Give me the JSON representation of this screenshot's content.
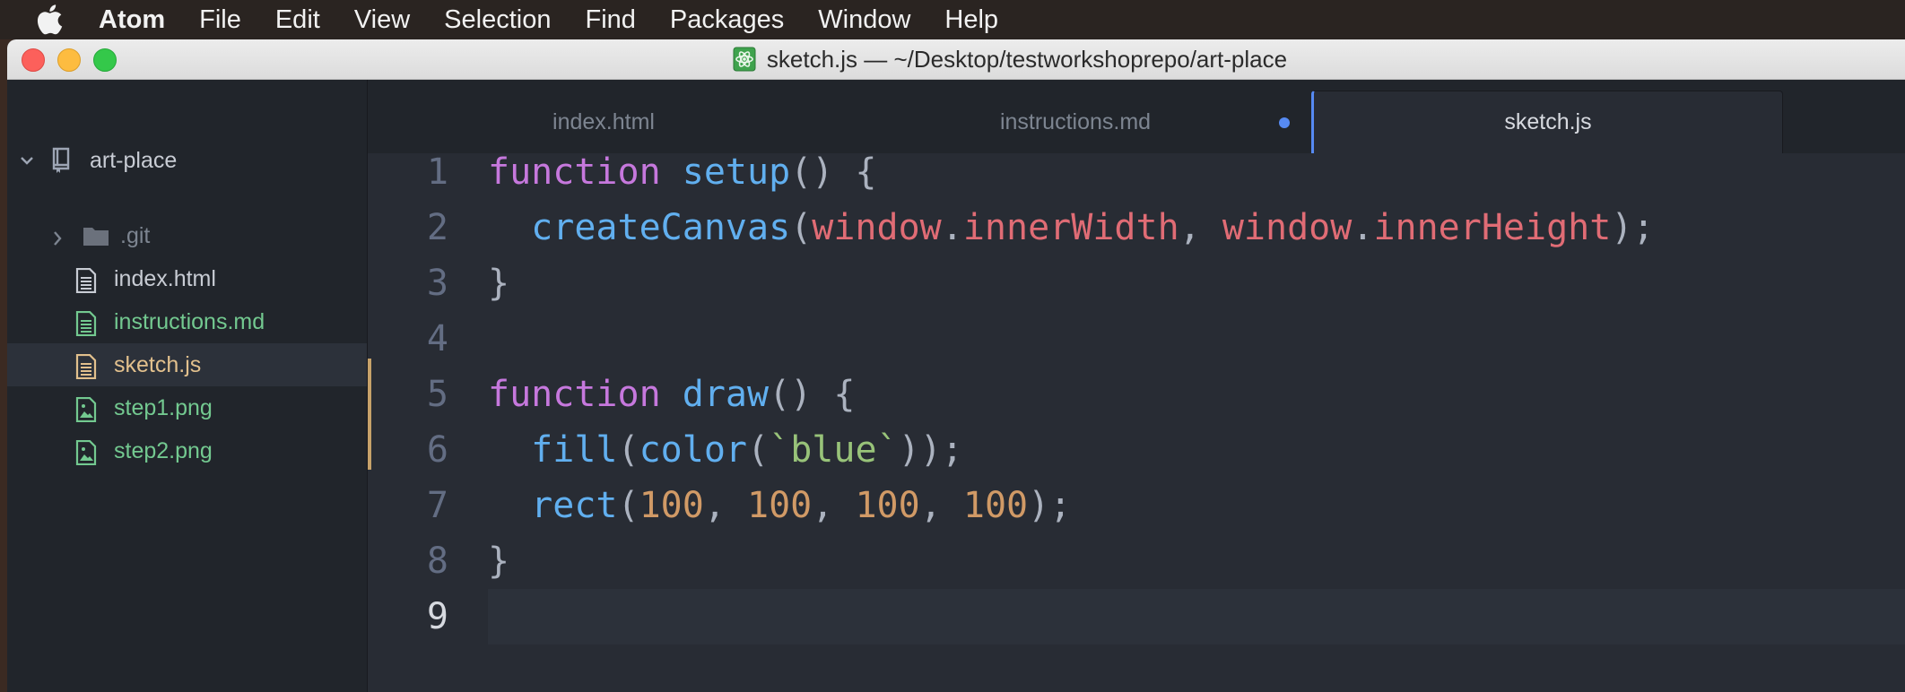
{
  "menubar": {
    "app": "Atom",
    "items": [
      "File",
      "Edit",
      "View",
      "Selection",
      "Find",
      "Packages",
      "Window",
      "Help"
    ]
  },
  "window": {
    "title": "sketch.js — ~/Desktop/testworkshoprepo/art-place"
  },
  "tree": {
    "root": "art-place",
    "entries": [
      {
        "name": ".git",
        "kind": "folder",
        "color": "#7d8591",
        "icon": "folder-icon"
      },
      {
        "name": "index.html",
        "kind": "file",
        "color": "#c8ccd4",
        "icon": "file-text-icon"
      },
      {
        "name": "instructions.md",
        "kind": "file",
        "color": "#73c990",
        "icon": "file-text-icon"
      },
      {
        "name": "sketch.js",
        "kind": "file",
        "color": "#e2c08d",
        "icon": "file-text-icon",
        "selected": true
      },
      {
        "name": "step1.png",
        "kind": "file",
        "color": "#73c990",
        "icon": "file-image-icon"
      },
      {
        "name": "step2.png",
        "kind": "file",
        "color": "#73c990",
        "icon": "file-image-icon"
      }
    ]
  },
  "tabs": [
    {
      "label": "index.html",
      "active": false,
      "modified": false
    },
    {
      "label": "instructions.md",
      "active": false,
      "modified": true
    },
    {
      "label": "sketch.js",
      "active": true,
      "modified": false
    }
  ],
  "editor": {
    "line_numbers": [
      "1",
      "2",
      "3",
      "4",
      "5",
      "6",
      "7",
      "8",
      "9"
    ],
    "cursor_line": 9,
    "lines": [
      [
        [
          "function",
          "kw"
        ],
        [
          " ",
          "pn"
        ],
        [
          "setup",
          "fn"
        ],
        [
          "() {",
          "pn"
        ]
      ],
      [
        [
          "  ",
          "pn"
        ],
        [
          "createCanvas",
          "fn"
        ],
        [
          "(",
          "pn"
        ],
        [
          "window",
          "vr"
        ],
        [
          ".",
          "pn"
        ],
        [
          "innerWidth",
          "vr"
        ],
        [
          ", ",
          "pn"
        ],
        [
          "window",
          "vr"
        ],
        [
          ".",
          "pn"
        ],
        [
          "innerHeight",
          "vr"
        ],
        [
          ");",
          "pn"
        ]
      ],
      [
        [
          "}",
          "pn"
        ]
      ],
      [],
      [
        [
          "function",
          "kw"
        ],
        [
          " ",
          "pn"
        ],
        [
          "draw",
          "fn"
        ],
        [
          "() {",
          "pn"
        ]
      ],
      [
        [
          "  ",
          "pn"
        ],
        [
          "fill",
          "fn"
        ],
        [
          "(",
          "pn"
        ],
        [
          "color",
          "fn"
        ],
        [
          "(",
          "pn"
        ],
        [
          "`blue`",
          "st"
        ],
        [
          "));",
          "pn"
        ]
      ],
      [
        [
          "  ",
          "pn"
        ],
        [
          "rect",
          "fn"
        ],
        [
          "(",
          "pn"
        ],
        [
          "100",
          "nm"
        ],
        [
          ", ",
          "pn"
        ],
        [
          "100",
          "nm"
        ],
        [
          ", ",
          "pn"
        ],
        [
          "100",
          "nm"
        ],
        [
          ", ",
          "pn"
        ],
        [
          "100",
          "nm"
        ],
        [
          ");",
          "pn"
        ]
      ],
      [
        [
          "}",
          "pn"
        ]
      ],
      []
    ]
  }
}
